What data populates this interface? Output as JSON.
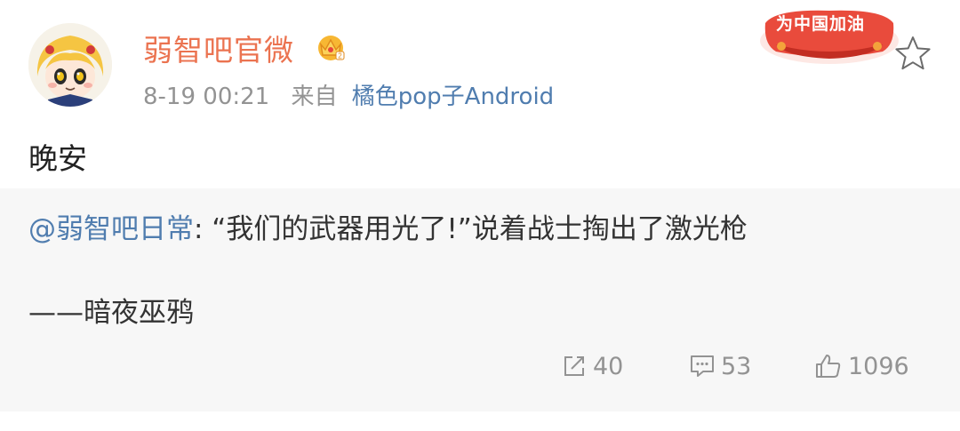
{
  "post": {
    "username": "弱智吧官微",
    "time": "8-19 00:21",
    "source_prefix": "来自",
    "source_app": "橘色pop子Android",
    "campaign_badge": "为中国加油",
    "text": "晚安",
    "repost": {
      "mention": "@弱智吧日常",
      "separator": ":",
      "quote": " “我们的武器用光了!”说着战士掏出了激光枪",
      "attribution": "——暗夜巫鸦"
    },
    "actions": {
      "repost_count": "40",
      "comment_count": "53",
      "like_count": "1096"
    }
  },
  "colors": {
    "username": "#eb7350",
    "link": "#507daf",
    "meta": "#939393",
    "repost_bg": "#f7f7f7"
  },
  "icons": {
    "avatar": "cartoon-avatar",
    "vip": "crown-badge-icon",
    "favorite": "star-icon",
    "repost": "repost-icon",
    "comment": "comment-icon",
    "like": "thumbs-up-icon"
  }
}
